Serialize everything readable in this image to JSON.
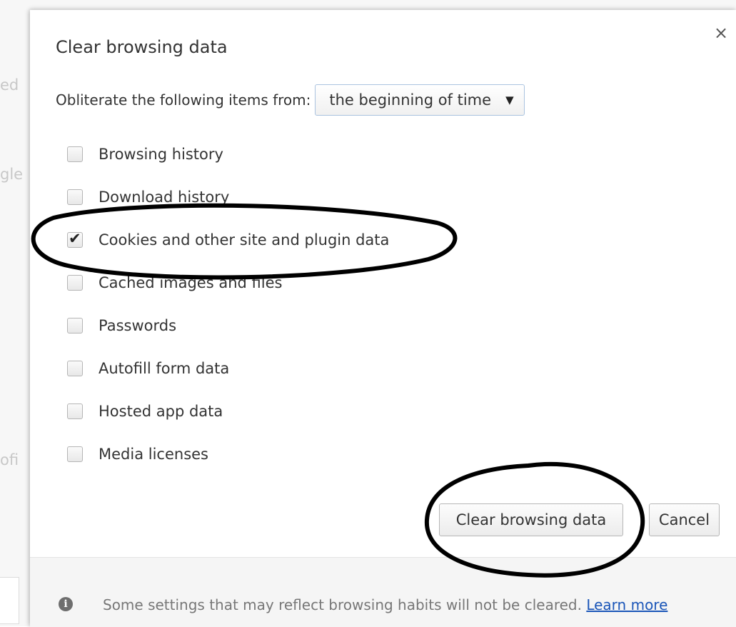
{
  "background": {
    "fragments": [
      "ed",
      "gle",
      "ofi"
    ]
  },
  "dialog": {
    "title": "Clear browsing data",
    "close_glyph": "×",
    "range_label": "Obliterate the following items from:",
    "range_value": "the beginning of time",
    "items": [
      {
        "label": "Browsing history",
        "checked": false
      },
      {
        "label": "Download history",
        "checked": false
      },
      {
        "label": "Cookies and other site and plugin data",
        "checked": true
      },
      {
        "label": "Cached images and files",
        "checked": false
      },
      {
        "label": "Passwords",
        "checked": false
      },
      {
        "label": "Autofill form data",
        "checked": false
      },
      {
        "label": "Hosted app data",
        "checked": false
      },
      {
        "label": "Media licenses",
        "checked": false
      }
    ],
    "clear_button_label": "Clear browsing data",
    "cancel_button_label": "Cancel",
    "footer_text": "Some settings that may reflect browsing habits will not be cleared.",
    "learn_more_label": "Learn more"
  },
  "icons": {
    "close": "close-icon",
    "dropdown": "dropdown-arrow-icon",
    "check": "checkmark-icon",
    "info": "info-icon"
  },
  "colors": {
    "link": "#1a55b8",
    "annotation": "#000000"
  }
}
